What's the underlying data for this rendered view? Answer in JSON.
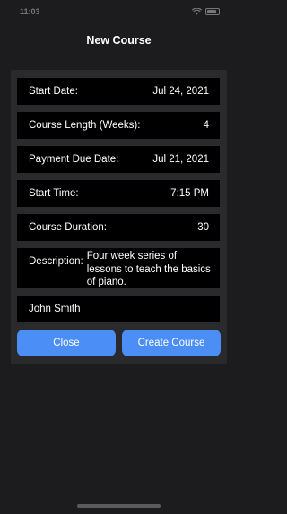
{
  "status_bar": {
    "time": "11:03"
  },
  "nav": {
    "title": "New Course"
  },
  "form": {
    "start_date": {
      "label": "Start Date:",
      "value": "Jul 24, 2021"
    },
    "course_length": {
      "label": "Course Length (Weeks):",
      "value": "4"
    },
    "payment_due": {
      "label": "Payment Due Date:",
      "value": "Jul 21, 2021"
    },
    "start_time": {
      "label": "Start Time:",
      "value": "7:15 PM"
    },
    "course_duration": {
      "label": "Course Duration:",
      "value": "30"
    },
    "description": {
      "label": "Description:",
      "value": "Four week series of lessons to teach the basics of piano."
    },
    "instructor": {
      "value": "John Smith"
    }
  },
  "buttons": {
    "close": "Close",
    "create": "Create Course"
  },
  "colors": {
    "accent": "#4a8ef6",
    "background": "#1c1c1e",
    "card": "#2a2a2c",
    "row": "#000000"
  },
  "icons": {
    "wifi": "wifi-icon",
    "battery": "battery-icon"
  }
}
